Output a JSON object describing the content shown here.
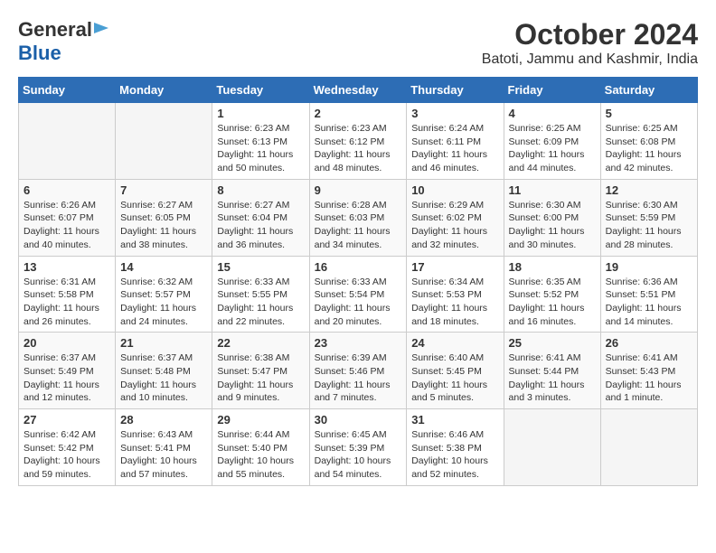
{
  "header": {
    "logo_general": "General",
    "logo_blue": "Blue",
    "month_year": "October 2024",
    "location": "Batoti, Jammu and Kashmir, India"
  },
  "days_of_week": [
    "Sunday",
    "Monday",
    "Tuesday",
    "Wednesday",
    "Thursday",
    "Friday",
    "Saturday"
  ],
  "weeks": [
    [
      {
        "day": "",
        "empty": true
      },
      {
        "day": "",
        "empty": true
      },
      {
        "day": "1",
        "sunrise": "6:23 AM",
        "sunset": "6:13 PM",
        "daylight": "11 hours and 50 minutes."
      },
      {
        "day": "2",
        "sunrise": "6:23 AM",
        "sunset": "6:12 PM",
        "daylight": "11 hours and 48 minutes."
      },
      {
        "day": "3",
        "sunrise": "6:24 AM",
        "sunset": "6:11 PM",
        "daylight": "11 hours and 46 minutes."
      },
      {
        "day": "4",
        "sunrise": "6:25 AM",
        "sunset": "6:09 PM",
        "daylight": "11 hours and 44 minutes."
      },
      {
        "day": "5",
        "sunrise": "6:25 AM",
        "sunset": "6:08 PM",
        "daylight": "11 hours and 42 minutes."
      }
    ],
    [
      {
        "day": "6",
        "sunrise": "6:26 AM",
        "sunset": "6:07 PM",
        "daylight": "11 hours and 40 minutes."
      },
      {
        "day": "7",
        "sunrise": "6:27 AM",
        "sunset": "6:05 PM",
        "daylight": "11 hours and 38 minutes."
      },
      {
        "day": "8",
        "sunrise": "6:27 AM",
        "sunset": "6:04 PM",
        "daylight": "11 hours and 36 minutes."
      },
      {
        "day": "9",
        "sunrise": "6:28 AM",
        "sunset": "6:03 PM",
        "daylight": "11 hours and 34 minutes."
      },
      {
        "day": "10",
        "sunrise": "6:29 AM",
        "sunset": "6:02 PM",
        "daylight": "11 hours and 32 minutes."
      },
      {
        "day": "11",
        "sunrise": "6:30 AM",
        "sunset": "6:00 PM",
        "daylight": "11 hours and 30 minutes."
      },
      {
        "day": "12",
        "sunrise": "6:30 AM",
        "sunset": "5:59 PM",
        "daylight": "11 hours and 28 minutes."
      }
    ],
    [
      {
        "day": "13",
        "sunrise": "6:31 AM",
        "sunset": "5:58 PM",
        "daylight": "11 hours and 26 minutes."
      },
      {
        "day": "14",
        "sunrise": "6:32 AM",
        "sunset": "5:57 PM",
        "daylight": "11 hours and 24 minutes."
      },
      {
        "day": "15",
        "sunrise": "6:33 AM",
        "sunset": "5:55 PM",
        "daylight": "11 hours and 22 minutes."
      },
      {
        "day": "16",
        "sunrise": "6:33 AM",
        "sunset": "5:54 PM",
        "daylight": "11 hours and 20 minutes."
      },
      {
        "day": "17",
        "sunrise": "6:34 AM",
        "sunset": "5:53 PM",
        "daylight": "11 hours and 18 minutes."
      },
      {
        "day": "18",
        "sunrise": "6:35 AM",
        "sunset": "5:52 PM",
        "daylight": "11 hours and 16 minutes."
      },
      {
        "day": "19",
        "sunrise": "6:36 AM",
        "sunset": "5:51 PM",
        "daylight": "11 hours and 14 minutes."
      }
    ],
    [
      {
        "day": "20",
        "sunrise": "6:37 AM",
        "sunset": "5:49 PM",
        "daylight": "11 hours and 12 minutes."
      },
      {
        "day": "21",
        "sunrise": "6:37 AM",
        "sunset": "5:48 PM",
        "daylight": "11 hours and 10 minutes."
      },
      {
        "day": "22",
        "sunrise": "6:38 AM",
        "sunset": "5:47 PM",
        "daylight": "11 hours and 9 minutes."
      },
      {
        "day": "23",
        "sunrise": "6:39 AM",
        "sunset": "5:46 PM",
        "daylight": "11 hours and 7 minutes."
      },
      {
        "day": "24",
        "sunrise": "6:40 AM",
        "sunset": "5:45 PM",
        "daylight": "11 hours and 5 minutes."
      },
      {
        "day": "25",
        "sunrise": "6:41 AM",
        "sunset": "5:44 PM",
        "daylight": "11 hours and 3 minutes."
      },
      {
        "day": "26",
        "sunrise": "6:41 AM",
        "sunset": "5:43 PM",
        "daylight": "11 hours and 1 minute."
      }
    ],
    [
      {
        "day": "27",
        "sunrise": "6:42 AM",
        "sunset": "5:42 PM",
        "daylight": "10 hours and 59 minutes."
      },
      {
        "day": "28",
        "sunrise": "6:43 AM",
        "sunset": "5:41 PM",
        "daylight": "10 hours and 57 minutes."
      },
      {
        "day": "29",
        "sunrise": "6:44 AM",
        "sunset": "5:40 PM",
        "daylight": "10 hours and 55 minutes."
      },
      {
        "day": "30",
        "sunrise": "6:45 AM",
        "sunset": "5:39 PM",
        "daylight": "10 hours and 54 minutes."
      },
      {
        "day": "31",
        "sunrise": "6:46 AM",
        "sunset": "5:38 PM",
        "daylight": "10 hours and 52 minutes."
      },
      {
        "day": "",
        "empty": true
      },
      {
        "day": "",
        "empty": true
      }
    ]
  ],
  "labels": {
    "sunrise": "Sunrise:",
    "sunset": "Sunset:",
    "daylight": "Daylight:"
  }
}
